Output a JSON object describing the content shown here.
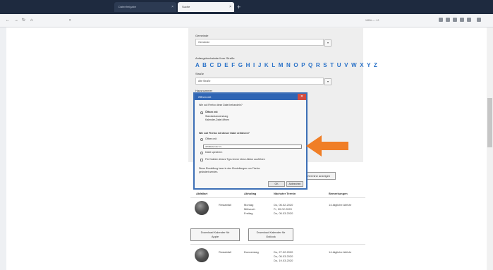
{
  "tabs": [
    {
      "label": "Datenfreigabe",
      "close": "×"
    },
    {
      "label": "Suche",
      "close": "×"
    }
  ],
  "new_tab": "+",
  "nav": {
    "url_prefix": "",
    "url_domain": "",
    "url_rest": "",
    "zoom": "100% — + 0"
  },
  "form": {
    "first_label": "Gemeinde",
    "first_value": "Gemeinde",
    "initial_label": "Anfangsbuchstabe Ihrer Straße",
    "alphabet": "A B C D E F G H I J K L M N O P Q R S T U V W X Y Z",
    "street_label": "Straße",
    "street_value": "Alte Straße",
    "house_label": "Hausnummer",
    "search_button": "Abfuhrtermine anzeigen"
  },
  "dialog": {
    "title": "Öffnen mit",
    "intro": "Wie soll Firefox diese Datei behandeln?",
    "open_with": "Öffnen mit",
    "open_with_detail_1": "Standardanwendung",
    "open_with_detail_2": "Kalender-Datei öffnen",
    "save_heading": "Wie soll Firefox mit dieser Datei verfahren?",
    "option_open": "Öffnen mit",
    "password_value": "abfallkalender.ics",
    "option_save": "Datei speichern",
    "remember": "Für Dateien dieses Typs immer diese Aktion ausführen",
    "note_1": "Diese Einstellung kann in den Einstellungen von Firefox",
    "note_2": "geändert werden.",
    "ok": "OK",
    "cancel": "Abbrechen"
  },
  "results": {
    "headers": [
      "Abfallart",
      "Abholtag",
      "Nächster Termin",
      "Bemerkungen"
    ],
    "rows": [
      {
        "type": "Restabfall",
        "days": "Montag\nMittwoch\nFreitag",
        "dates": "Do, 06.02.2020\nFr, 20.02.2020\nDo, 05.03.2020",
        "note": "14-tägliche Abfuhr"
      },
      {
        "type": "Restabfall",
        "days": "Donnerstag",
        "dates": "Do, 27.02.2020\nDo, 05.03.2020\nDo, 19.03.2020",
        "note": "14-tägliche Abfuhr"
      }
    ],
    "download_1": "Download Kalender für\nApple",
    "download_2": "Download Kalender für\nOutlook"
  },
  "colors": {
    "accent": "#2f65b4",
    "arrow": "#f07e26",
    "link": "#2a72c8"
  }
}
